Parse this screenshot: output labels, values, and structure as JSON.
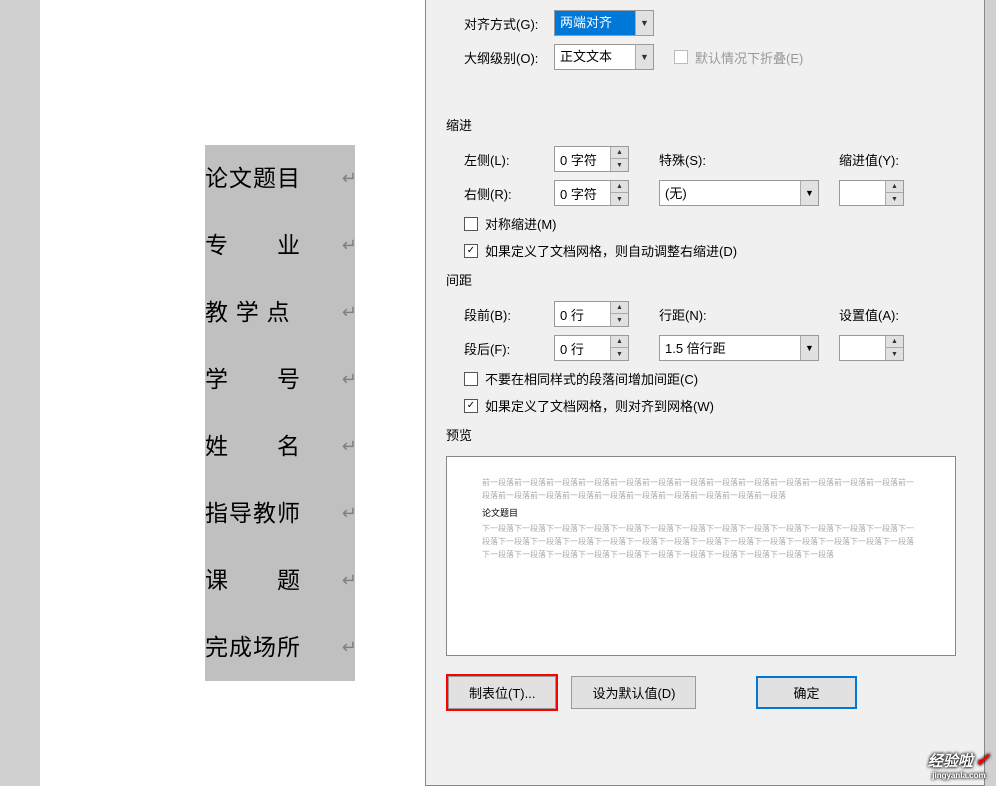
{
  "document": {
    "lines": [
      "论文题目",
      "专　　业",
      "教 学 点",
      "学　　号",
      "姓　　名",
      "指导教师",
      "课　　题",
      "完成场所"
    ],
    "para_mark": "↵"
  },
  "dialog": {
    "general": {
      "alignment_label": "对齐方式(G):",
      "alignment_value": "两端对齐",
      "outline_label": "大纲级别(O):",
      "outline_value": "正文文本",
      "collapse_label": "默认情况下折叠(E)",
      "collapse_checked": false
    },
    "indent": {
      "section": "缩进",
      "left_label": "左侧(L):",
      "left_value": "0 字符",
      "right_label": "右侧(R):",
      "right_value": "0 字符",
      "special_label": "特殊(S):",
      "special_value": "(无)",
      "by_label": "缩进值(Y):",
      "by_value": "",
      "mirror_label": "对称缩进(M)",
      "mirror_checked": false,
      "grid_label": "如果定义了文档网格，则自动调整右缩进(D)",
      "grid_checked": true
    },
    "spacing": {
      "section": "间距",
      "before_label": "段前(B):",
      "before_value": "0 行",
      "after_label": "段后(F):",
      "after_value": "0 行",
      "line_label": "行距(N):",
      "line_value": "1.5 倍行距",
      "at_label": "设置值(A):",
      "at_value": "",
      "nospace_label": "不要在相同样式的段落间增加间距(C)",
      "nospace_checked": false,
      "snap_label": "如果定义了文档网格，则对齐到网格(W)",
      "snap_checked": true
    },
    "preview": {
      "section": "预览",
      "prev_para": "前一段落前一段落前一段落前一段落前一段落前一段落前一段落前一段落前一段落前一段落前一段落前一段落前一段落前一段落前一段落前一段落前一段落前一段落前一段落前一段落前一段落前一段落前一段落",
      "sample": "论文题目",
      "next_para": "下一段落下一段落下一段落下一段落下一段落下一段落下一段落下一段落下一段落下一段落下一段落下一段落下一段落下一段落下一段落下一段落下一段落下一段落下一段落下一段落下一段落下一段落下一段落下一段落下一段落下一段落下一段落下一段落下一段落下一段落下一段落下一段落下一段落下一段落下一段落下一段落下一段落下一段落"
    },
    "buttons": {
      "tabs": "制表位(T)...",
      "default": "设为默认值(D)",
      "ok": "确定"
    }
  },
  "watermark": {
    "main": "经验啦",
    "sub": "jingyanla.com",
    "check": "✓"
  }
}
